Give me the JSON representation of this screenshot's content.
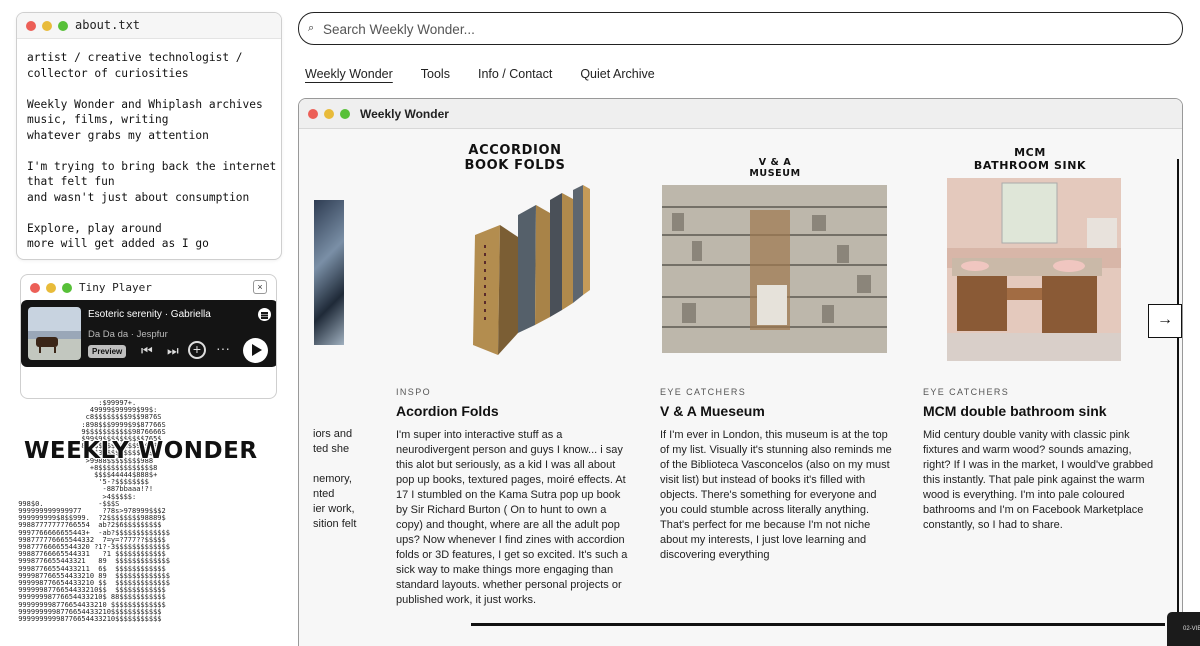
{
  "about": {
    "title": "about.txt",
    "body": "artist / creative technologist /\ncollector of curiosities\n\nWeekly Wonder and Whiplash archives\nmusic, films, writing\nwhatever grabs my attention\n\nI'm trying to bring back the internet\nthat felt fun\nand wasn't just about consumption\n\nExplore, play around\nmore will get added as I go"
  },
  "player": {
    "title": "Tiny Player",
    "close": "×",
    "track": "Esoteric serenity · Gabriella",
    "artist": "Da Da da · Jespfur",
    "preview": "Preview"
  },
  "logo": "WEEKLY WONDER",
  "search": {
    "placeholder": "Search Weekly Wonder..."
  },
  "nav": [
    "Weekly Wonder",
    "Tools",
    "Info / Contact",
    "Quiet Archive"
  ],
  "window": {
    "title": "Weekly Wonder"
  },
  "partial_lines": [
    "iors and",
    "ted she",
    "",
    "nemory,",
    "nted",
    "ier work,",
    "sition felt"
  ],
  "cards": [
    {
      "image_title": "ACCORDION\nBOOK FOLDS",
      "category": "INSPO",
      "title": "Acordion Folds",
      "body": "I'm super into interactive stuff as a neurodivergent person and guys I know... i say this alot but seriously, as a kid I was all about pop up books, textured pages, moiré effects. At 17 I stumbled on the Kama Sutra pop up book by Sir Richard Burton ( On to hunt to own a copy) and thought, where are all the adult pop ups? Now whenever I find zines with accordion folds or 3D features, I get so excited. It's such a sick way to make things more engaging than standard layouts. whether personal projects or published work, it just works."
    },
    {
      "image_title": "V & A\nMUSEUM",
      "category": "EYE CATCHERS",
      "title": "V & A Mueseum",
      "body": "If I'm ever in London, this museum is at the top of my list. Visually it's stunning also reminds me of the Biblioteca Vasconcelos (also on my must visit list) but instead of books it's filled with objects. There's something for everyone and you could stumble across literally anything. That's perfect for me because I'm not niche about my interests, I just love learning and discovering everything"
    },
    {
      "image_title": "MCM\nBATHROOM SINK",
      "category": "EYE CATCHERS",
      "title": "MCM double bathroom sink",
      "body": "Mid century double vanity with classic pink fixtures and warm wood? sounds amazing, right? If I was in the market, I would've grabbed this instantly. That pale pink against the warm wood is everything. I'm into pale coloured bathrooms and I'm on Facebook Marketplace constantly, so I had to share."
    }
  ],
  "next_arrow": "→",
  "corner_label": "02-VIE"
}
